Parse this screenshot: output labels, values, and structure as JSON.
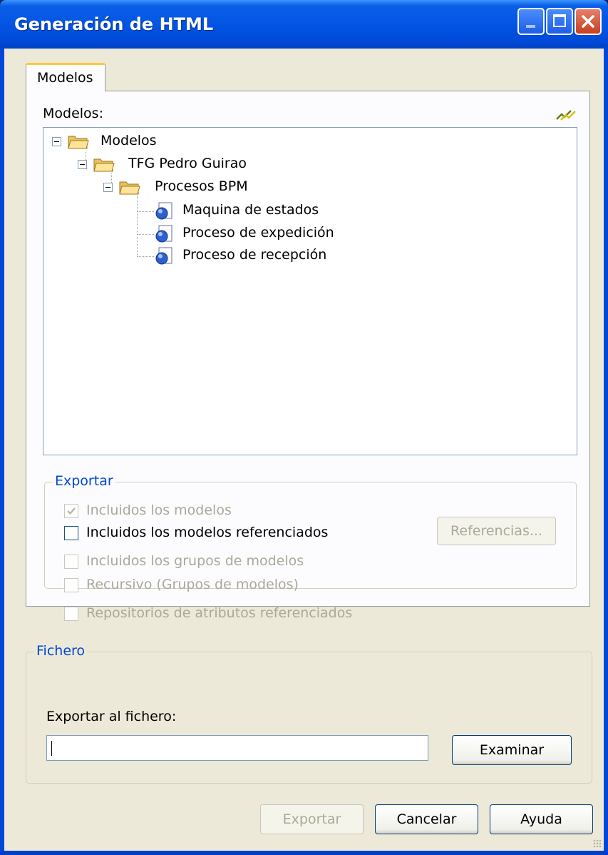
{
  "window": {
    "title": "Generación de HTML"
  },
  "tabs": [
    {
      "label": "Modelos"
    }
  ],
  "models_label": "Modelos:",
  "tree": {
    "root": "Modelos",
    "project": "TFG Pedro Guirao",
    "folder": "Procesos BPM",
    "items": [
      "Maquina de estados",
      "Proceso de expedición",
      "Proceso de recepción"
    ]
  },
  "export_group": {
    "title": "Exportar",
    "options": [
      {
        "label": "Incluidos los modelos",
        "checked": true,
        "enabled": false
      },
      {
        "label": "Incluidos los modelos referenciados",
        "checked": false,
        "enabled": true
      },
      {
        "label": "Incluidos los grupos de modelos",
        "checked": false,
        "enabled": false
      },
      {
        "label": "Recursivo (Grupos de modelos)",
        "checked": false,
        "enabled": false
      },
      {
        "label": "Repositorios de atributos referenciados",
        "checked": false,
        "enabled": false
      }
    ],
    "references_button": "Referencias..."
  },
  "file_group": {
    "title": "Fichero",
    "export_label": "Exportar al fichero:",
    "file_value": "",
    "browse_button": "Examinar"
  },
  "buttons": {
    "export": "Exportar",
    "cancel": "Cancelar",
    "help": "Ayuda"
  }
}
